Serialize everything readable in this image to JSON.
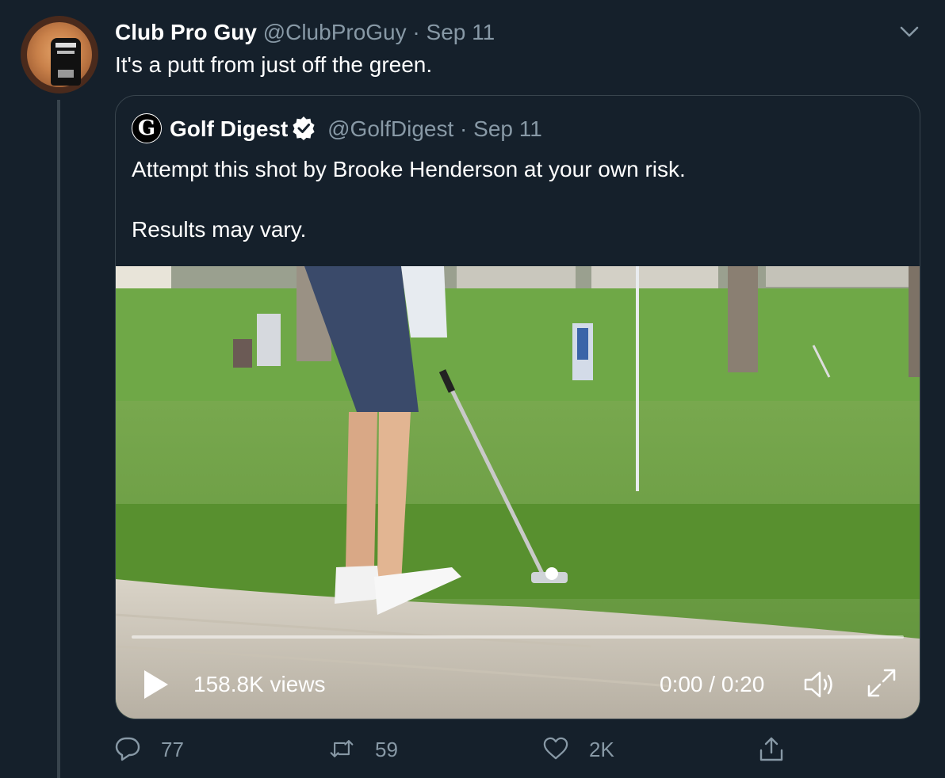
{
  "tweet": {
    "display_name": "Club Pro Guy",
    "handle": "@ClubProGuy",
    "separator": "·",
    "date": "Sep 11",
    "text": "It's a putt from just off the green."
  },
  "quoted_tweet": {
    "logo_letter": "G",
    "display_name": "Golf Digest",
    "handle": "@GolfDigest",
    "separator": "·",
    "date": "Sep 11",
    "text_line1": "Attempt this shot by Brooke Henderson at your own risk.",
    "text_line2": "Results may vary."
  },
  "video": {
    "views": "158.8K views",
    "time": "0:00 / 0:20",
    "progress": 0
  },
  "actions": {
    "replies": "77",
    "retweets": "59",
    "likes": "2K"
  },
  "colors": {
    "background": "#15202b",
    "border": "#38444d",
    "secondary_text": "#8899a6",
    "primary_text": "#ffffff"
  },
  "icons": [
    "chevron-down-icon",
    "verified-badge-icon",
    "play-icon",
    "volume-icon",
    "fullscreen-icon",
    "reply-icon",
    "retweet-icon",
    "like-icon",
    "share-icon"
  ]
}
